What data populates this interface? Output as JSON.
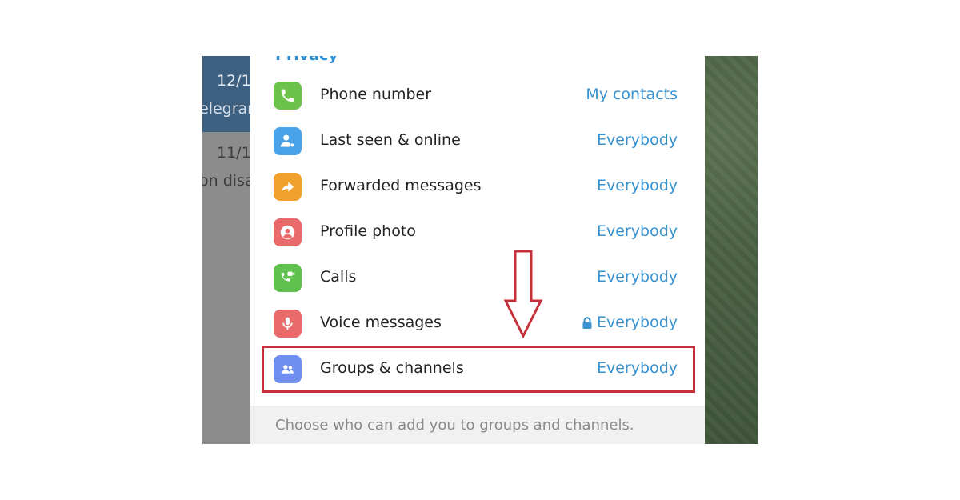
{
  "sidebar": {
    "date_1": "12/1",
    "snippet_1": "elegram",
    "date_2": "11/1",
    "snippet_2": "on disa"
  },
  "privacy": {
    "section_title": "Privacy",
    "rows": [
      {
        "label": "Phone number",
        "value": "My contacts",
        "icon": "phone-icon",
        "color": "#6cc24a"
      },
      {
        "label": "Last seen & online",
        "value": "Everybody",
        "icon": "user-online-icon",
        "color": "#4aa3e8"
      },
      {
        "label": "Forwarded messages",
        "value": "Everybody",
        "icon": "forward-icon",
        "color": "#f0a12d"
      },
      {
        "label": "Profile photo",
        "value": "Everybody",
        "icon": "profile-photo-icon",
        "color": "#e86a6a"
      },
      {
        "label": "Calls",
        "value": "Everybody",
        "icon": "video-call-icon",
        "color": "#5fc24d"
      },
      {
        "label": "Voice messages",
        "value": "Everybody",
        "icon": "microphone-icon",
        "color": "#e86a6a",
        "locked": true
      },
      {
        "label": "Groups & channels",
        "value": "Everybody",
        "icon": "group-icon",
        "color": "#6f8ff0"
      }
    ],
    "footer_hint": "Choose who can add you to groups and channels."
  },
  "annotation": {
    "highlight_color": "#c5303a",
    "target": "Groups & channels"
  }
}
